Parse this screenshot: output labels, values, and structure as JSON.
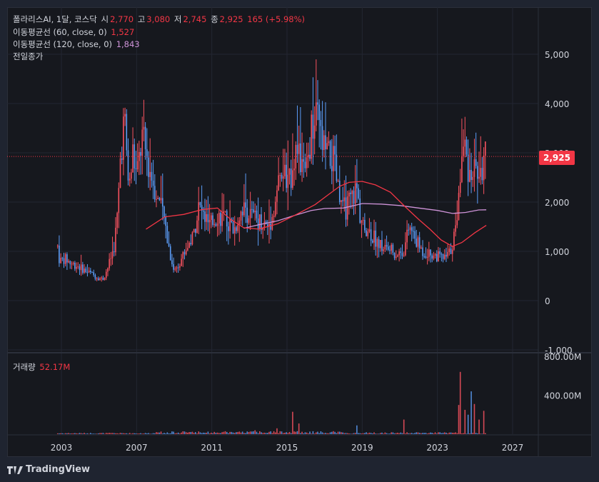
{
  "legend": {
    "symbol": "폴라리스AI, 1달, 코스닥",
    "open_label": "시",
    "open": "2,770",
    "high_label": "고",
    "high": "3,080",
    "low_label": "저",
    "low": "2,745",
    "close_label": "종",
    "close": "2,925",
    "change": "165 (+5.98%)",
    "ma60_label": "이동평균선 (60, close, 0)",
    "ma60_value": "1,527",
    "ma120_label": "이동평균선 (120, close, 0)",
    "ma120_value": "1,843",
    "prev_close_label": "전일종가",
    "volume_label": "거래량",
    "volume_value": "52.17M"
  },
  "current_price": "2,925",
  "brand": "TradingView",
  "colors": {
    "up": "#f7525f",
    "down": "#5b9cf6",
    "ma60": "#f23645",
    "ma120": "#ce93d8"
  },
  "chart_data": {
    "type": "candlestick",
    "x_ticks": [
      "2003",
      "2007",
      "2011",
      "2015",
      "2019",
      "2023",
      "2027"
    ],
    "y_ticks": [
      "5,000",
      "4,000",
      "3,000",
      "2,000",
      "1,000",
      "0",
      "-1,000"
    ],
    "y_range": [
      -1000,
      5000
    ],
    "volume_ticks": [
      "800.00M",
      "400.00M"
    ],
    "volume_range": [
      0,
      800
    ],
    "prev_close": 2925,
    "price_anchors": [
      [
        2002.8,
        1100
      ],
      [
        2002.9,
        800
      ],
      [
        2003.2,
        850
      ],
      [
        2003.5,
        760
      ],
      [
        2003.9,
        700
      ],
      [
        2004.3,
        600
      ],
      [
        2004.8,
        500
      ],
      [
        2005.2,
        430
      ],
      [
        2005.5,
        700
      ],
      [
        2005.8,
        1100
      ],
      [
        2006.0,
        1800
      ],
      [
        2006.15,
        3000
      ],
      [
        2006.35,
        3700
      ],
      [
        2006.6,
        2200
      ],
      [
        2006.8,
        3000
      ],
      [
        2007.0,
        2500
      ],
      [
        2007.3,
        3300
      ],
      [
        2007.6,
        2800
      ],
      [
        2007.9,
        2400
      ],
      [
        2008.2,
        2000
      ],
      [
        2008.5,
        1600
      ],
      [
        2008.8,
        900
      ],
      [
        2009.0,
        600
      ],
      [
        2009.3,
        800
      ],
      [
        2009.7,
        1100
      ],
      [
        2010.0,
        1300
      ],
      [
        2010.3,
        1900
      ],
      [
        2010.6,
        1700
      ],
      [
        2010.9,
        1500
      ],
      [
        2011.3,
        1750
      ],
      [
        2011.8,
        1600
      ],
      [
        2012.2,
        1450
      ],
      [
        2012.6,
        1900
      ],
      [
        2013.0,
        1750
      ],
      [
        2013.5,
        1650
      ],
      [
        2013.9,
        1500
      ],
      [
        2014.2,
        1650
      ],
      [
        2014.5,
        2300
      ],
      [
        2014.8,
        2600
      ],
      [
        2015.1,
        2300
      ],
      [
        2015.4,
        3100
      ],
      [
        2015.7,
        2800
      ],
      [
        2016.0,
        2500
      ],
      [
        2016.3,
        3400
      ],
      [
        2016.6,
        3700
      ],
      [
        2016.9,
        3100
      ],
      [
        2017.2,
        2900
      ],
      [
        2017.5,
        2800
      ],
      [
        2017.8,
        2000
      ],
      [
        2018.1,
        1850
      ],
      [
        2018.4,
        2050
      ],
      [
        2018.7,
        2300
      ],
      [
        2018.9,
        1700
      ],
      [
        2019.2,
        1500
      ],
      [
        2019.6,
        1300
      ],
      [
        2020.0,
        1100
      ],
      [
        2020.4,
        1050
      ],
      [
        2020.8,
        950
      ],
      [
        2021.2,
        1000
      ],
      [
        2021.5,
        1500
      ],
      [
        2021.8,
        1250
      ],
      [
        2022.2,
        1000
      ],
      [
        2022.6,
        950
      ],
      [
        2023.0,
        900
      ],
      [
        2023.4,
        850
      ],
      [
        2023.7,
        1000
      ],
      [
        2024.0,
        1500
      ],
      [
        2024.2,
        2500
      ],
      [
        2024.4,
        3200
      ],
      [
        2024.7,
        2600
      ],
      [
        2025.0,
        2700
      ],
      [
        2025.3,
        2500
      ],
      [
        2025.5,
        2900
      ],
      [
        2025.6,
        2925
      ]
    ],
    "ma60": [
      [
        2007.5,
        1450
      ],
      [
        2008.5,
        1700
      ],
      [
        2009.5,
        1750
      ],
      [
        2010.5,
        1850
      ],
      [
        2011.3,
        1880
      ],
      [
        2012.0,
        1650
      ],
      [
        2012.7,
        1480
      ],
      [
        2013.5,
        1450
      ],
      [
        2014.5,
        1560
      ],
      [
        2015.5,
        1750
      ],
      [
        2016.5,
        1950
      ],
      [
        2017.2,
        2150
      ],
      [
        2017.8,
        2320
      ],
      [
        2018.3,
        2400
      ],
      [
        2019.0,
        2420
      ],
      [
        2019.7,
        2350
      ],
      [
        2020.5,
        2200
      ],
      [
        2021.3,
        1900
      ],
      [
        2022.0,
        1650
      ],
      [
        2022.6,
        1450
      ],
      [
        2023.2,
        1230
      ],
      [
        2023.8,
        1100
      ],
      [
        2024.3,
        1180
      ],
      [
        2025.0,
        1380
      ],
      [
        2025.6,
        1527
      ]
    ],
    "ma120": [
      [
        2012.7,
        1470
      ],
      [
        2013.5,
        1540
      ],
      [
        2014.5,
        1620
      ],
      [
        2015.5,
        1740
      ],
      [
        2016.3,
        1830
      ],
      [
        2017.0,
        1870
      ],
      [
        2018.0,
        1880
      ],
      [
        2019.0,
        1970
      ],
      [
        2020.0,
        1960
      ],
      [
        2021.0,
        1930
      ],
      [
        2022.0,
        1880
      ],
      [
        2023.0,
        1830
      ],
      [
        2023.8,
        1770
      ],
      [
        2024.5,
        1790
      ],
      [
        2025.2,
        1840
      ],
      [
        2025.6,
        1843
      ]
    ],
    "volume_spikes": [
      [
        2013.3,
        40
      ],
      [
        2014.5,
        60
      ],
      [
        2015.3,
        230
      ],
      [
        2015.6,
        110
      ],
      [
        2018.7,
        90
      ],
      [
        2021.2,
        150
      ],
      [
        2024.1,
        300
      ],
      [
        2024.25,
        640
      ],
      [
        2024.45,
        250
      ],
      [
        2024.6,
        200
      ],
      [
        2024.8,
        440
      ],
      [
        2025.0,
        310
      ],
      [
        2025.2,
        150
      ],
      [
        2025.5,
        240
      ],
      [
        2025.6,
        52
      ]
    ]
  }
}
